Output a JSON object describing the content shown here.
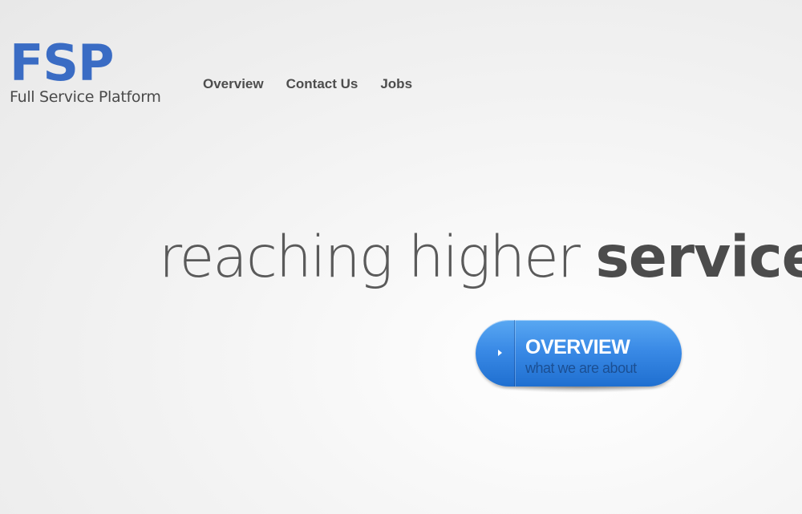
{
  "logo": {
    "mark": "FSP",
    "tagline": "Full Service Platform"
  },
  "nav": {
    "items": [
      {
        "label": "Overview"
      },
      {
        "label": "Contact Us"
      },
      {
        "label": "Jobs"
      }
    ]
  },
  "hero": {
    "headline_light": "reaching higher",
    "headline_bold": "service"
  },
  "cta": {
    "title": "OVERVIEW",
    "subtitle": "what we are about",
    "icon": "play-arrow-icon",
    "color": "#3a8ae6"
  },
  "colors": {
    "brand": "#3a6cc4",
    "text": "#4d4d4d"
  }
}
